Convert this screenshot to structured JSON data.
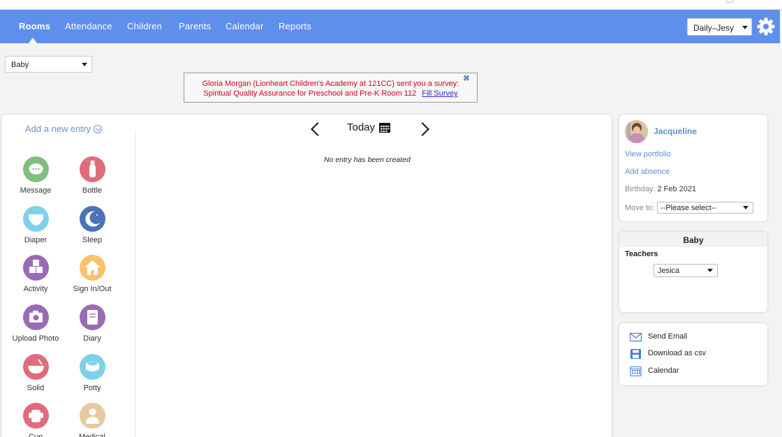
{
  "nav": {
    "items": [
      "Rooms",
      "Attendance",
      "Children",
      "Parents",
      "Calendar",
      "Reports"
    ],
    "active": "Rooms",
    "user_select": "Daily–Jesy"
  },
  "room_filter": {
    "selected": "Baby"
  },
  "survey": {
    "line1": "Gloria Morgan (Lionheart Children's Academy at 121CC) sent you a survey:",
    "line2": "Spiritual Quality Assurance for Preschool and Pre-K Room 112",
    "link": "Fill Survey",
    "close": "✖"
  },
  "entries": {
    "add_label": "Add a new entry",
    "items": [
      {
        "label": "Message",
        "icon": "message-icon",
        "color": "#7fbf7f"
      },
      {
        "label": "Bottle",
        "icon": "bottle-icon",
        "color": "#e06c7a"
      },
      {
        "label": "Diaper",
        "icon": "diaper-icon",
        "color": "#7fd0ea"
      },
      {
        "label": "Sleep",
        "icon": "moon-icon",
        "color": "#4a73b8"
      },
      {
        "label": "Activity",
        "icon": "blocks-icon",
        "color": "#9a6bb5"
      },
      {
        "label": "Sign In/Out",
        "icon": "house-icon",
        "color": "#fbc16b"
      },
      {
        "label": "Upload Photo",
        "icon": "camera-icon",
        "color": "#9a6bb5"
      },
      {
        "label": "Diary",
        "icon": "diary-icon",
        "color": "#9a6bb5"
      },
      {
        "label": "Solid",
        "icon": "bowl-icon",
        "color": "#e06c7a"
      },
      {
        "label": "Potty",
        "icon": "potty-icon",
        "color": "#7fd0ea"
      },
      {
        "label": "Cup",
        "icon": "cup-icon",
        "color": "#e06c7a"
      },
      {
        "label": "Medical",
        "icon": "doctor-icon",
        "color": "#e6c9a0"
      }
    ]
  },
  "day": {
    "label": "Today",
    "empty_message": "No entry has been created"
  },
  "child": {
    "name": "Jacqueline",
    "view_portfolio": "View portfolio",
    "add_absence": "Add absence",
    "birthday_label": "Birthday:",
    "birthday_value": "2 Feb 2021",
    "move_label": "Move to:",
    "move_placeholder": "--Please select--"
  },
  "room_card": {
    "title": "Baby",
    "teachers_label": "Teachers",
    "teacher_selected": "Jesica"
  },
  "actions": [
    "Send Email",
    "Download as csv",
    "Calendar"
  ]
}
